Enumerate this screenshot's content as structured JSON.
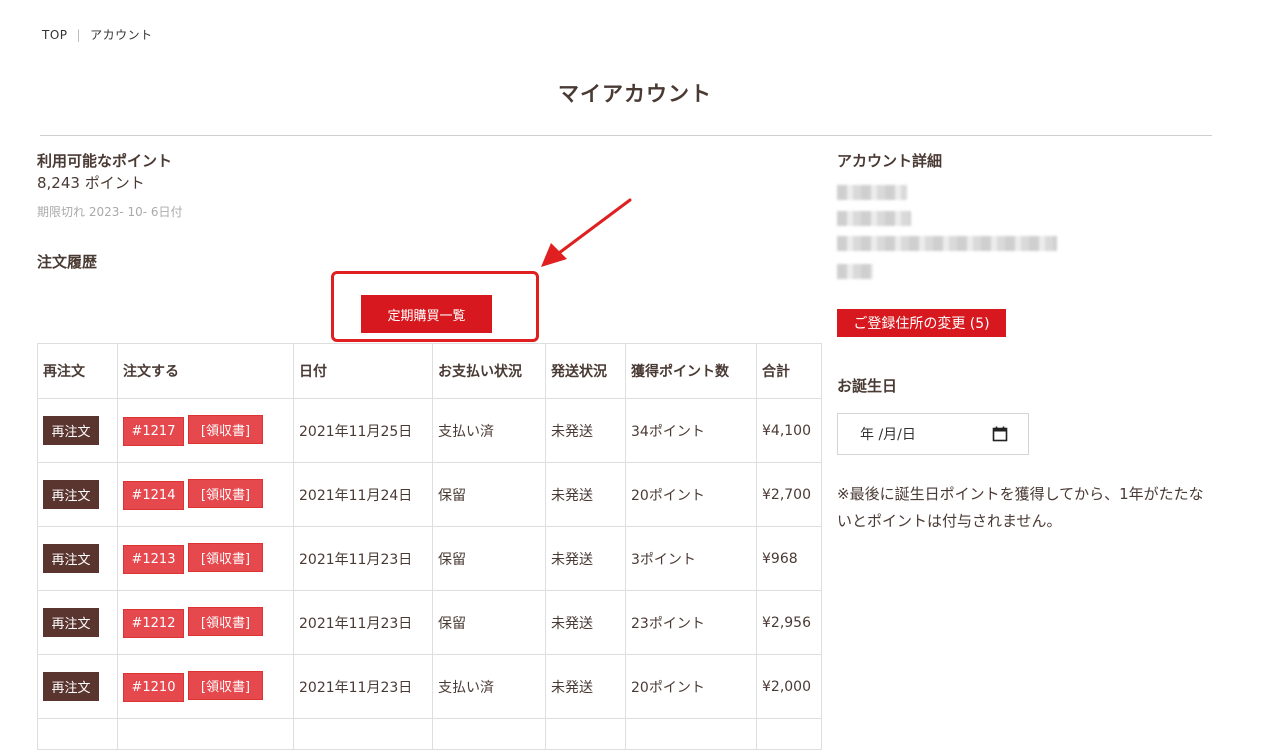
{
  "breadcrumb": {
    "top": "TOP",
    "separator": "|",
    "current": "アカウント"
  },
  "page_title": "マイアカウント",
  "points": {
    "label": "利用可能なポイント",
    "value": "8,243 ポイント",
    "expiry": "期限切れ 2023- 10- 6日付"
  },
  "order_history": {
    "label": "注文履歴",
    "subscription_button": "定期購買一覧",
    "columns": [
      "再注文",
      "注文する",
      "日付",
      "お支払い状況",
      "発送状況",
      "獲得ポイント数",
      "合計"
    ],
    "rows": [
      {
        "reorder": "再注文",
        "order_no": "#1217",
        "receipt": "[領収書]",
        "date": "2021年11月25日",
        "payment": "支払い済",
        "shipping": "未発送",
        "points": "34ポイント",
        "total": "¥4,100"
      },
      {
        "reorder": "再注文",
        "order_no": "#1214",
        "receipt": "[領収書]",
        "date": "2021年11月24日",
        "payment": "保留",
        "shipping": "未発送",
        "points": "20ポイント",
        "total": "¥2,700"
      },
      {
        "reorder": "再注文",
        "order_no": "#1213",
        "receipt": "[領収書]",
        "date": "2021年11月23日",
        "payment": "保留",
        "shipping": "未発送",
        "points": "3ポイント",
        "total": "¥968"
      },
      {
        "reorder": "再注文",
        "order_no": "#1212",
        "receipt": "[領収書]",
        "date": "2021年11月23日",
        "payment": "保留",
        "shipping": "未発送",
        "points": "23ポイント",
        "total": "¥2,956"
      },
      {
        "reorder": "再注文",
        "order_no": "#1210",
        "receipt": "[領収書]",
        "date": "2021年11月23日",
        "payment": "支払い済",
        "shipping": "未発送",
        "points": "20ポイント",
        "total": "¥2,000"
      }
    ]
  },
  "account": {
    "label": "アカウント詳細",
    "address_button": "ご登録住所の変更 (5)"
  },
  "birthday": {
    "label": "お誕生日",
    "placeholder": "年 /月/日",
    "note": "※最後に誕生日ポイントを獲得してから、1年がたたないとポイントは付与されません。"
  },
  "icons": {
    "calendar": "calendar-icon",
    "arrow": "annotation-arrow"
  },
  "colors": {
    "primary_red": "#d7191f",
    "dark_brown": "#5a3530",
    "light_red": "#e5484d",
    "text": "#4a3a34"
  }
}
